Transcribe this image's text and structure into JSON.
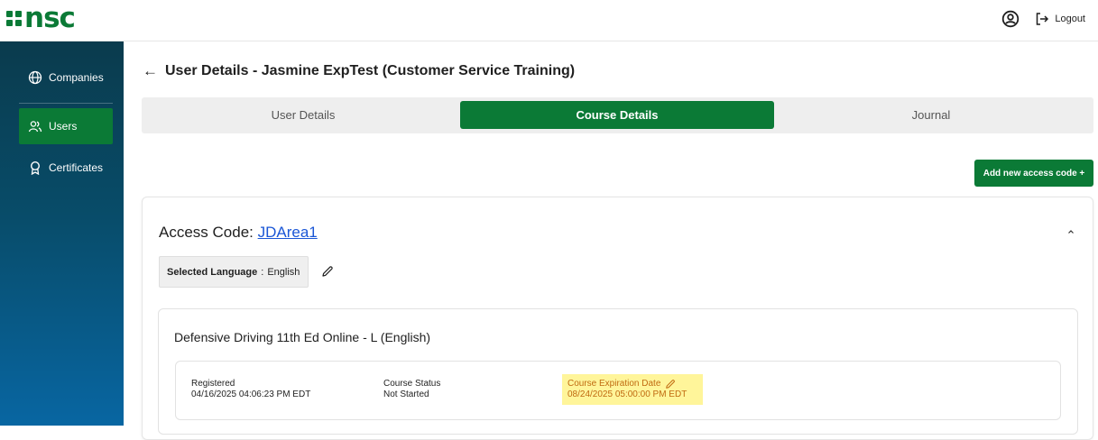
{
  "header": {
    "logo": "nsc",
    "logout_label": "Logout"
  },
  "sidebar": {
    "items": [
      {
        "label": "Companies",
        "icon": "globe-icon"
      },
      {
        "label": "Users",
        "icon": "users-icon",
        "active": true
      },
      {
        "label": "Certificates",
        "icon": "award-icon"
      }
    ]
  },
  "main": {
    "title": "User Details - Jasmine ExpTest (Customer Service Training)",
    "tabs": [
      {
        "label": "User Details"
      },
      {
        "label": "Course Details",
        "active": true
      },
      {
        "label": "Journal"
      }
    ],
    "add_button_label": "Add new access code +",
    "access_code_label": "Access Code:",
    "access_code_value": "JDArea1",
    "selected_language_label": "Selected Language",
    "selected_language_sep": ":",
    "selected_language_value": "English",
    "course": {
      "title": "Defensive Driving 11th Ed Online - L (English)",
      "registered_label": "Registered",
      "registered_value": "04/16/2025 04:06:23 PM EDT",
      "status_label": "Course Status",
      "status_value": "Not Started",
      "expiration_label": "Course Expiration Date",
      "expiration_value": "08/24/2025 05:00:00 PM EDT"
    }
  },
  "colors": {
    "brand_green": "#0b7a36",
    "sidebar_top": "#0a3b4d",
    "sidebar_bottom": "#0866a2",
    "link_blue": "#1a56d6",
    "highlight": "#fff59a"
  }
}
